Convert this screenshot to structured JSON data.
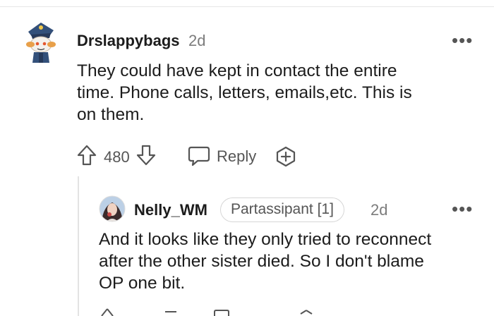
{
  "comments": [
    {
      "username": "Drslappybags",
      "age": "2d",
      "menu_label": "•••",
      "lines": [
        "They could have kept in contact the entire",
        "time. Phone calls, letters, emails,etc. This is",
        "on them."
      ],
      "vote_count": "480",
      "reply_label": "Reply",
      "icons": {
        "upvote": "arrow-up-icon",
        "downvote": "arrow-down-icon",
        "reply": "speech-bubble-icon",
        "award": "award-plus-icon",
        "menu": "more-dots-icon"
      }
    },
    {
      "username": "Nelly_WM",
      "flair": "Partassipant [1]",
      "age": "2d",
      "menu_label": "•••",
      "lines": [
        "And it looks like they only tried to reconnect",
        "after the other sister died. So I don't blame",
        "OP one bit."
      ]
    }
  ],
  "colors": {
    "text": "#1c1c1c",
    "muted": "#7c7c7c",
    "icon": "#555555",
    "divider": "#e6e6e6"
  }
}
